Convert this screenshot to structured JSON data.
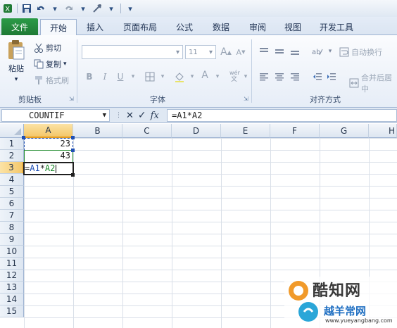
{
  "quick_access": {
    "icons": [
      "excel-logo-icon",
      "save-icon",
      "undo-icon",
      "redo-icon",
      "customize-icon"
    ]
  },
  "tabs": [
    {
      "label": "文件"
    },
    {
      "label": "开始"
    },
    {
      "label": "插入"
    },
    {
      "label": "页面布局"
    },
    {
      "label": "公式"
    },
    {
      "label": "数据"
    },
    {
      "label": "审阅"
    },
    {
      "label": "视图"
    },
    {
      "label": "开发工具"
    }
  ],
  "ribbon": {
    "clipboard": {
      "paste": "粘贴",
      "cut": "剪切",
      "copy": "复制",
      "format_painter": "格式刷",
      "group_label": "剪贴板"
    },
    "font": {
      "font_size": "11",
      "bold": "B",
      "italic": "I",
      "underline": "U",
      "grow": "A",
      "shrink": "A",
      "font_color": "A",
      "group_label": "字体"
    },
    "alignment": {
      "wrap_text": "自动换行",
      "merge_center": "合并后居中",
      "group_label": "对齐方式"
    }
  },
  "formula_bar": {
    "name_box": "COUNTIF",
    "cancel": "✕",
    "enter": "✓",
    "fx": "fx",
    "formula": "=A1*A2"
  },
  "sheet": {
    "columns": [
      "A",
      "B",
      "C",
      "D",
      "E",
      "F",
      "G",
      "H"
    ],
    "rows": [
      "1",
      "2",
      "3",
      "4",
      "5",
      "6",
      "7",
      "8",
      "9",
      "10",
      "11",
      "12",
      "13",
      "14",
      "15"
    ],
    "cells": {
      "A1": "23",
      "A2": "43",
      "A3_ref1": "A1",
      "A3_ref2": "A2",
      "A3_eq": "=",
      "A3_op": "*"
    }
  },
  "watermark": {
    "brand": "酷知网",
    "brand2": "越羊常网",
    "url": "www.yueyangbang.com"
  },
  "colors": {
    "file_tab": "#1f7a35",
    "ref_blue": "#1f4fb4",
    "ref_green": "#1d8a2a",
    "selection_orange": "#f4c76a"
  }
}
